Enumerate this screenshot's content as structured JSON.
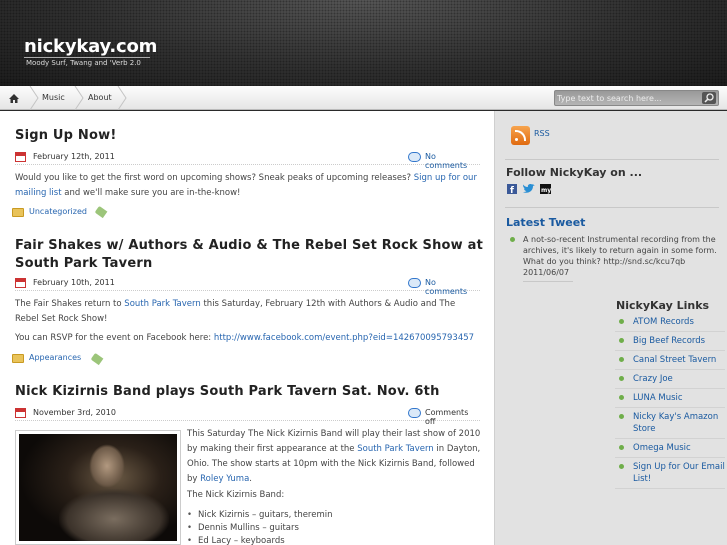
{
  "site": {
    "title": "nickykay.com",
    "description": "Moody Surf, Twang and 'Verb 2.0"
  },
  "nav": {
    "items": [
      "Music",
      "About"
    ],
    "search_placeholder": "Type text to search here..."
  },
  "posts": [
    {
      "title": "Sign Up Now!",
      "date": "February 12th, 2011",
      "comments": "No comments",
      "body_prefix": "Would you like to get the first word on upcoming shows? Sneak peaks of upcoming releases? ",
      "body_link": "Sign up for our mailing list",
      "body_suffix": " and we'll make sure you are in-the-know!",
      "category": "Uncategorized"
    },
    {
      "title_line1": "Fair Shakes w/ Authors & Audio & The Rebel Set Rock Show at",
      "title_line2": "South Park Tavern",
      "date": "February 10th, 2011",
      "comments": "No comments",
      "p1_prefix": "The Fair Shakes return to ",
      "p1_link": "South Park Tavern",
      "p1_suffix": " this Saturday, February 12th with Authors & Audio and The Rebel Set Rock Show!",
      "p2_prefix": "You can RSVP for the event on Facebook here: ",
      "p2_link": "http://www.facebook.com/event.php?eid=142670095793457",
      "category": "Appearances"
    },
    {
      "title": "Nick Kizirnis Band plays South Park Tavern Sat. Nov. 6th",
      "date": "November 3rd, 2010",
      "comments": "Comments off",
      "p1_prefix": "This Saturday The Nick Kizirnis Band will play their last show of 2010 by making their first appearance at the ",
      "p1_link": "South Park Tavern",
      "p1_middle": " in Dayton, Ohio. The show starts at 10pm with the Nick Kizirnis Band, followed by ",
      "p1_link2": "Roley Yuma",
      "p1_suffix": ".",
      "p2": "The Nick Kizirnis Band:",
      "members": [
        "Nick Kizirnis – guitars, theremin",
        "Dennis Mullins – guitars",
        "Ed Lacy – keyboards"
      ]
    }
  ],
  "sidebar": {
    "rss": "RSS",
    "follow_title": "Follow NickyKay on ...",
    "latest_tweet_title": "Latest Tweet",
    "tweet": "A not-so-recent Instrumental recording from the archives, it's likely to return again in some form. What do you think? http://snd.sc/kcu7qb 2011/06/07",
    "links_title": "NickyKay Links",
    "links": [
      "ATOM Records",
      "Big Beef Records",
      "Canal Street Tavern",
      "Crazy Joe",
      "LUNA Music",
      "Nicky Kay's Amazon Store",
      "Omega Music",
      "Sign Up for Our Email List!"
    ]
  },
  "icons": [
    "home-icon",
    "search-icon",
    "calendar-icon",
    "comment-bubble-icon",
    "folder-icon",
    "tag-icon",
    "rss-icon",
    "facebook-icon",
    "twitter-icon",
    "myspace-icon"
  ],
  "colors": {
    "link": "#2866b0",
    "header_bg": "#333333",
    "sidebar_bg": "#e2e2e2",
    "bullet": "#6fae4a"
  }
}
